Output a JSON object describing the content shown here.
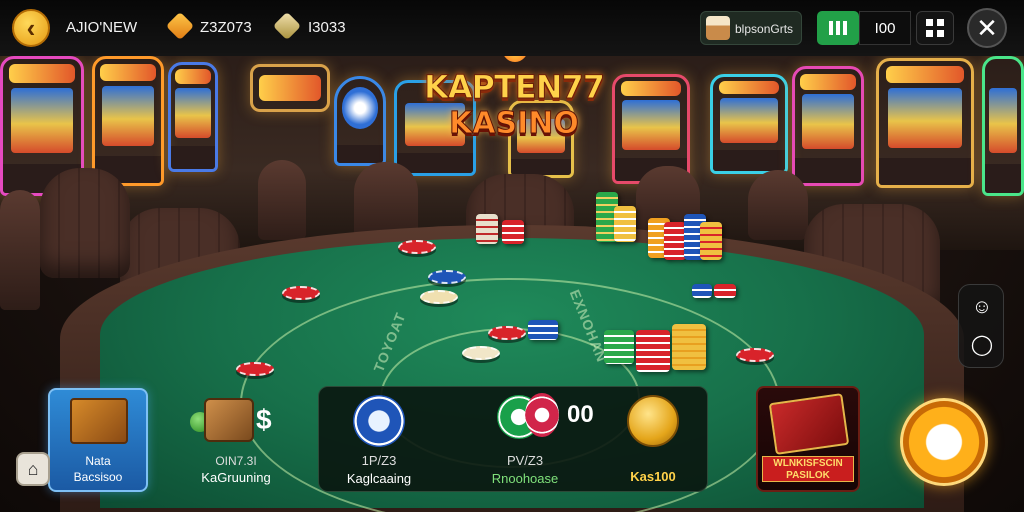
{
  "topbar": {
    "username": "AJIO'NEW",
    "gems": "Z3Z073",
    "coins": "I3033",
    "shop_label": "blpsonGrts",
    "count": "I00"
  },
  "logo": {
    "line1": "KAPTEN77",
    "line2": "KASINO"
  },
  "bottom": {
    "mystery_line1": "Nata",
    "mystery_line2": "Bacsisoo",
    "daily_line1": "OIN7.3I",
    "daily_line2": "KaGruuning",
    "daily_currency": "$",
    "center": {
      "left_line1": "1P/Z3",
      "left_line2": "Kaglcaaing",
      "mid_line1": "PV/Z3",
      "mid_line2": "Rnoohoase",
      "value": "00",
      "right_line1": "Kas100"
    },
    "tourney_line1": "WLNKISFSCIN",
    "tourney_line2": "PASILOK"
  },
  "colors": {
    "felt": "#17704a",
    "accent_gold": "#ffb01a",
    "mystery_blue": "#1b5aa4",
    "signal_green": "#22a048"
  },
  "icons": [
    "chevron-left-icon",
    "gem-icon",
    "coin-icon",
    "cupcake-icon",
    "signal-bars-icon",
    "grid-icon",
    "close-icon",
    "profile-icon",
    "chat-icon",
    "home-icon"
  ]
}
